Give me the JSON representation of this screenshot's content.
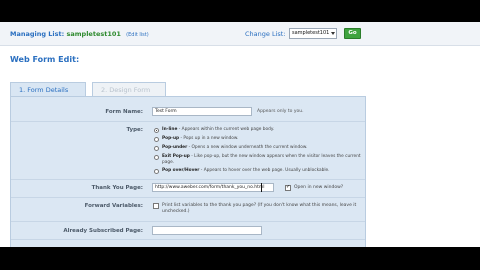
{
  "header": {
    "managing_label": "Managing List:",
    "list_name": "sampletest101",
    "edit_link": "(Edit list)",
    "change_list_label": "Change List:",
    "change_list_value": "sampletest101",
    "go_button": "Go"
  },
  "page_title": "Web Form Edit:",
  "tabs": [
    {
      "label": "1. Form Details",
      "active": true
    },
    {
      "label": "2. Design Form",
      "active": false
    }
  ],
  "form": {
    "form_name": {
      "label": "Form Name:",
      "value": "Test Form",
      "hint": "Appears only to you."
    },
    "type": {
      "label": "Type:",
      "options": [
        {
          "name": "In-line",
          "desc": " - Appears within the current web page body.",
          "selected": true
        },
        {
          "name": "Pop-up",
          "desc": " - Pops up in a new window.",
          "selected": false
        },
        {
          "name": "Pop-under",
          "desc": " - Opens a new window underneath the current window.",
          "selected": false
        },
        {
          "name": "Exit Pop-up",
          "desc": " - Like pop-up, but the new window appears when the visitor leaves the current page.",
          "selected": false
        },
        {
          "name": "Pop over/Hover",
          "desc": " - Appears to hover over the web page. Usually unblockable.",
          "selected": false
        }
      ]
    },
    "thank_you": {
      "label": "Thank You Page:",
      "value": "http://www.aweber.com/form/thank_you_no.html",
      "open_new_window": "Open in new window?"
    },
    "forward_variables": {
      "label": "Forward Variables:",
      "text": "Print list variables to the thank you page? (If you don't know what this means, leave it unchecked.)"
    },
    "already_subscribed": {
      "label": "Already Subscribed Page:",
      "value": ""
    }
  },
  "colors": {
    "link_blue": "#2a6fc0",
    "list_green": "#2e8a2e",
    "go_green": "#3fa33f",
    "panel_bg": "#dbe7f3"
  }
}
